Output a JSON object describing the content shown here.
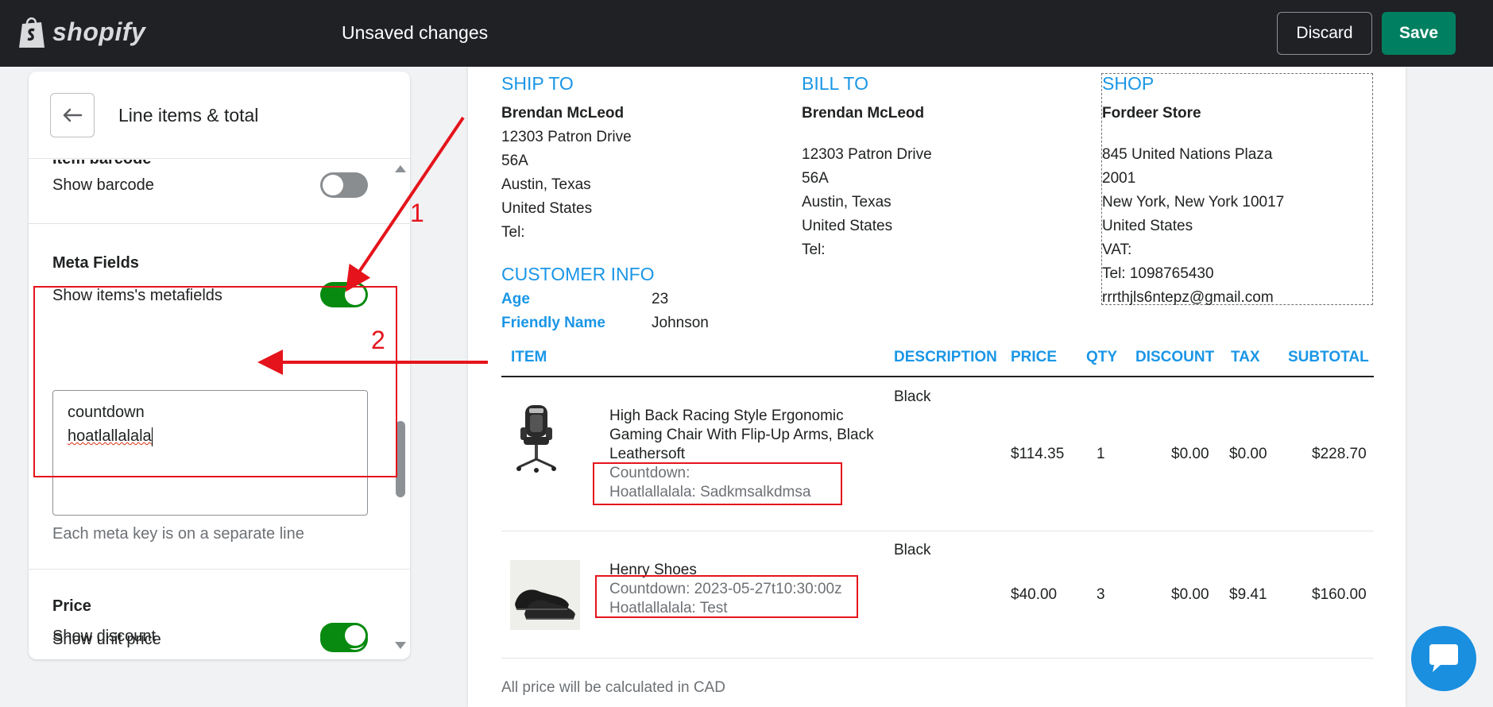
{
  "topbar": {
    "logo_text": "shopify",
    "status": "Unsaved changes",
    "discard_label": "Discard",
    "save_label": "Save"
  },
  "panel": {
    "title": "Line items & total",
    "sections": {
      "barcode_title": "Item barcode",
      "show_barcode": "Show barcode",
      "show_barcode_on": false,
      "meta_title": "Meta Fields",
      "show_metafields": "Show items's metafields",
      "show_metafields_on": true,
      "meta_keys_line1": "countdown",
      "meta_keys_line2": "hoatlallalala",
      "meta_help": "Each meta key is on a separate line",
      "price_title": "Price",
      "show_unit_price": "Show unit price",
      "show_unit_price_on": true,
      "show_discount": "Show discount",
      "show_discount_on": true
    }
  },
  "invoice": {
    "ship_to": {
      "heading": "SHIP TO",
      "name": "Brendan McLeod",
      "line1": "12303 Patron Drive",
      "line2": "56A",
      "line3": "Austin, Texas",
      "line4": "United States",
      "tel": "Tel:"
    },
    "bill_to": {
      "heading": "BILL TO",
      "name": "Brendan McLeod",
      "line1": "12303 Patron Drive",
      "line2": "56A",
      "line3": "Austin, Texas",
      "line4": "United States",
      "tel": "Tel:"
    },
    "shop": {
      "heading": "SHOP",
      "name": "Fordeer Store",
      "line1": "845 United Nations Plaza",
      "line2": "2001",
      "line3": "New York, New York 10017",
      "line4": "United States",
      "vat": "VAT:",
      "tel": "Tel: 1098765430",
      "email": "rrrthjls6ntepz@gmail.com"
    },
    "customer_info": {
      "heading": "CUSTOMER INFO",
      "age_key": "Age",
      "age_val": "23",
      "friendly_key": "Friendly Name",
      "friendly_val": "Johnson"
    },
    "columns": {
      "item": "ITEM",
      "description": "DESCRIPTION",
      "price": "PRICE",
      "qty": "QTY",
      "discount": "DISCOUNT",
      "tax": "TAX",
      "subtotal": "SUBTOTAL"
    },
    "rows": [
      {
        "title_l1": "High Back Racing Style Ergonomic",
        "title_l2": "Gaming Chair With Flip-Up Arms, Black",
        "title_l3": "Leathersoft",
        "meta1": "Countdown:",
        "meta2": "Hoatlallalala: Sadkmsalkdmsa",
        "description": "Black",
        "price": "$114.35",
        "qty": "1",
        "discount": "$0.00",
        "tax": "$0.00",
        "subtotal": "$228.70"
      },
      {
        "title_l1": "Henry Shoes",
        "meta1": "Countdown: 2023-05-27t10:30:00z",
        "meta2": "Hoatlallalala: Test",
        "description": "Black",
        "price": "$40.00",
        "qty": "3",
        "discount": "$0.00",
        "tax": "$9.41",
        "subtotal": "$160.00"
      }
    ],
    "footer_note": "All price will be calculated in CAD"
  },
  "annotations": {
    "label1": "1",
    "label2": "2",
    "color": "#e5141c"
  },
  "icons": {
    "back": "arrow-left-icon",
    "chat": "chat-icon",
    "logo": "shopify-bag-icon"
  }
}
